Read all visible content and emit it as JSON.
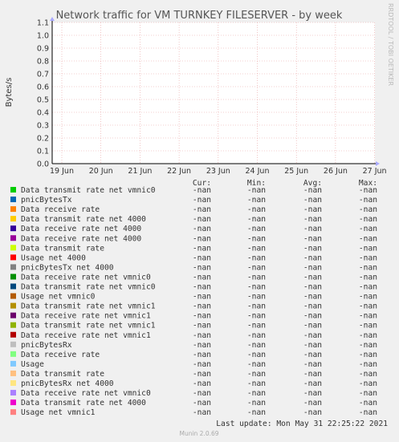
{
  "chart_data": {
    "type": "line",
    "title": "Network traffic for VM TURNKEY FILESERVER - by week",
    "ylabel": "Bytes/s",
    "side_label": "RRDTOOL / TOBI OETIKER",
    "ylim": [
      0.0,
      1.1
    ],
    "yticks": [
      "0.0",
      "0.1",
      "0.2",
      "0.3",
      "0.4",
      "0.5",
      "0.6",
      "0.7",
      "0.8",
      "0.9",
      "1.0",
      "1.1"
    ],
    "xticks": [
      "19 Jun",
      "20 Jun",
      "21 Jun",
      "22 Jun",
      "23 Jun",
      "24 Jun",
      "25 Jun",
      "26 Jun",
      "27 Jun"
    ],
    "grid": true,
    "columns": [
      "Cur:",
      "Min:",
      "Avg:",
      "Max:"
    ],
    "legend": [
      {
        "name": "Data transmit rate net vmnic0",
        "color": "#00cc00",
        "cur": "-nan",
        "min": "-nan",
        "avg": "-nan",
        "max": "-nan"
      },
      {
        "name": "pnicBytesTx",
        "color": "#0066b3",
        "cur": "-nan",
        "min": "-nan",
        "avg": "-nan",
        "max": "-nan"
      },
      {
        "name": "Data receive rate",
        "color": "#ff8000",
        "cur": "-nan",
        "min": "-nan",
        "avg": "-nan",
        "max": "-nan"
      },
      {
        "name": "Data transmit rate net 4000",
        "color": "#ffcc00",
        "cur": "-nan",
        "min": "-nan",
        "avg": "-nan",
        "max": "-nan"
      },
      {
        "name": "Data receive rate net 4000",
        "color": "#330099",
        "cur": "-nan",
        "min": "-nan",
        "avg": "-nan",
        "max": "-nan"
      },
      {
        "name": "Data receive rate net 4000",
        "color": "#990099",
        "cur": "-nan",
        "min": "-nan",
        "avg": "-nan",
        "max": "-nan"
      },
      {
        "name": "Data transmit rate",
        "color": "#ccff00",
        "cur": "-nan",
        "min": "-nan",
        "avg": "-nan",
        "max": "-nan"
      },
      {
        "name": "Usage net 4000",
        "color": "#ff0000",
        "cur": "-nan",
        "min": "-nan",
        "avg": "-nan",
        "max": "-nan"
      },
      {
        "name": "pnicBytesTx net 4000",
        "color": "#808080",
        "cur": "-nan",
        "min": "-nan",
        "avg": "-nan",
        "max": "-nan"
      },
      {
        "name": "Data receive rate net vmnic0",
        "color": "#008f00",
        "cur": "-nan",
        "min": "-nan",
        "avg": "-nan",
        "max": "-nan"
      },
      {
        "name": "Data transmit rate net vmnic0",
        "color": "#00487d",
        "cur": "-nan",
        "min": "-nan",
        "avg": "-nan",
        "max": "-nan"
      },
      {
        "name": "Usage net vmnic0",
        "color": "#b35a00",
        "cur": "-nan",
        "min": "-nan",
        "avg": "-nan",
        "max": "-nan"
      },
      {
        "name": "Data transmit rate net vmnic1",
        "color": "#b38f00",
        "cur": "-nan",
        "min": "-nan",
        "avg": "-nan",
        "max": "-nan"
      },
      {
        "name": "Data receive rate net vmnic1",
        "color": "#6b006b",
        "cur": "-nan",
        "min": "-nan",
        "avg": "-nan",
        "max": "-nan"
      },
      {
        "name": "Data transmit rate net vmnic1",
        "color": "#8fb300",
        "cur": "-nan",
        "min": "-nan",
        "avg": "-nan",
        "max": "-nan"
      },
      {
        "name": "Data receive rate net vmnic1",
        "color": "#b30000",
        "cur": "-nan",
        "min": "-nan",
        "avg": "-nan",
        "max": "-nan"
      },
      {
        "name": "pnicBytesRx",
        "color": "#bebebe",
        "cur": "-nan",
        "min": "-nan",
        "avg": "-nan",
        "max": "-nan"
      },
      {
        "name": "Data receive rate",
        "color": "#80ff80",
        "cur": "-nan",
        "min": "-nan",
        "avg": "-nan",
        "max": "-nan"
      },
      {
        "name": "Usage",
        "color": "#80c9ff",
        "cur": "-nan",
        "min": "-nan",
        "avg": "-nan",
        "max": "-nan"
      },
      {
        "name": "Data transmit rate",
        "color": "#ffc080",
        "cur": "-nan",
        "min": "-nan",
        "avg": "-nan",
        "max": "-nan"
      },
      {
        "name": "pnicBytesRx net 4000",
        "color": "#ffe680",
        "cur": "-nan",
        "min": "-nan",
        "avg": "-nan",
        "max": "-nan"
      },
      {
        "name": "Data receive rate net vmnic0",
        "color": "#aa80ff",
        "cur": "-nan",
        "min": "-nan",
        "avg": "-nan",
        "max": "-nan"
      },
      {
        "name": "Data transmit rate net 4000",
        "color": "#ee00cc",
        "cur": "-nan",
        "min": "-nan",
        "avg": "-nan",
        "max": "-nan"
      },
      {
        "name": "Usage net vmnic1",
        "color": "#ff8080",
        "cur": "-nan",
        "min": "-nan",
        "avg": "-nan",
        "max": "-nan"
      }
    ],
    "last_update": "Last update: Mon May 31 22:25:22 2021",
    "footer": "Munin 2.0.69"
  }
}
